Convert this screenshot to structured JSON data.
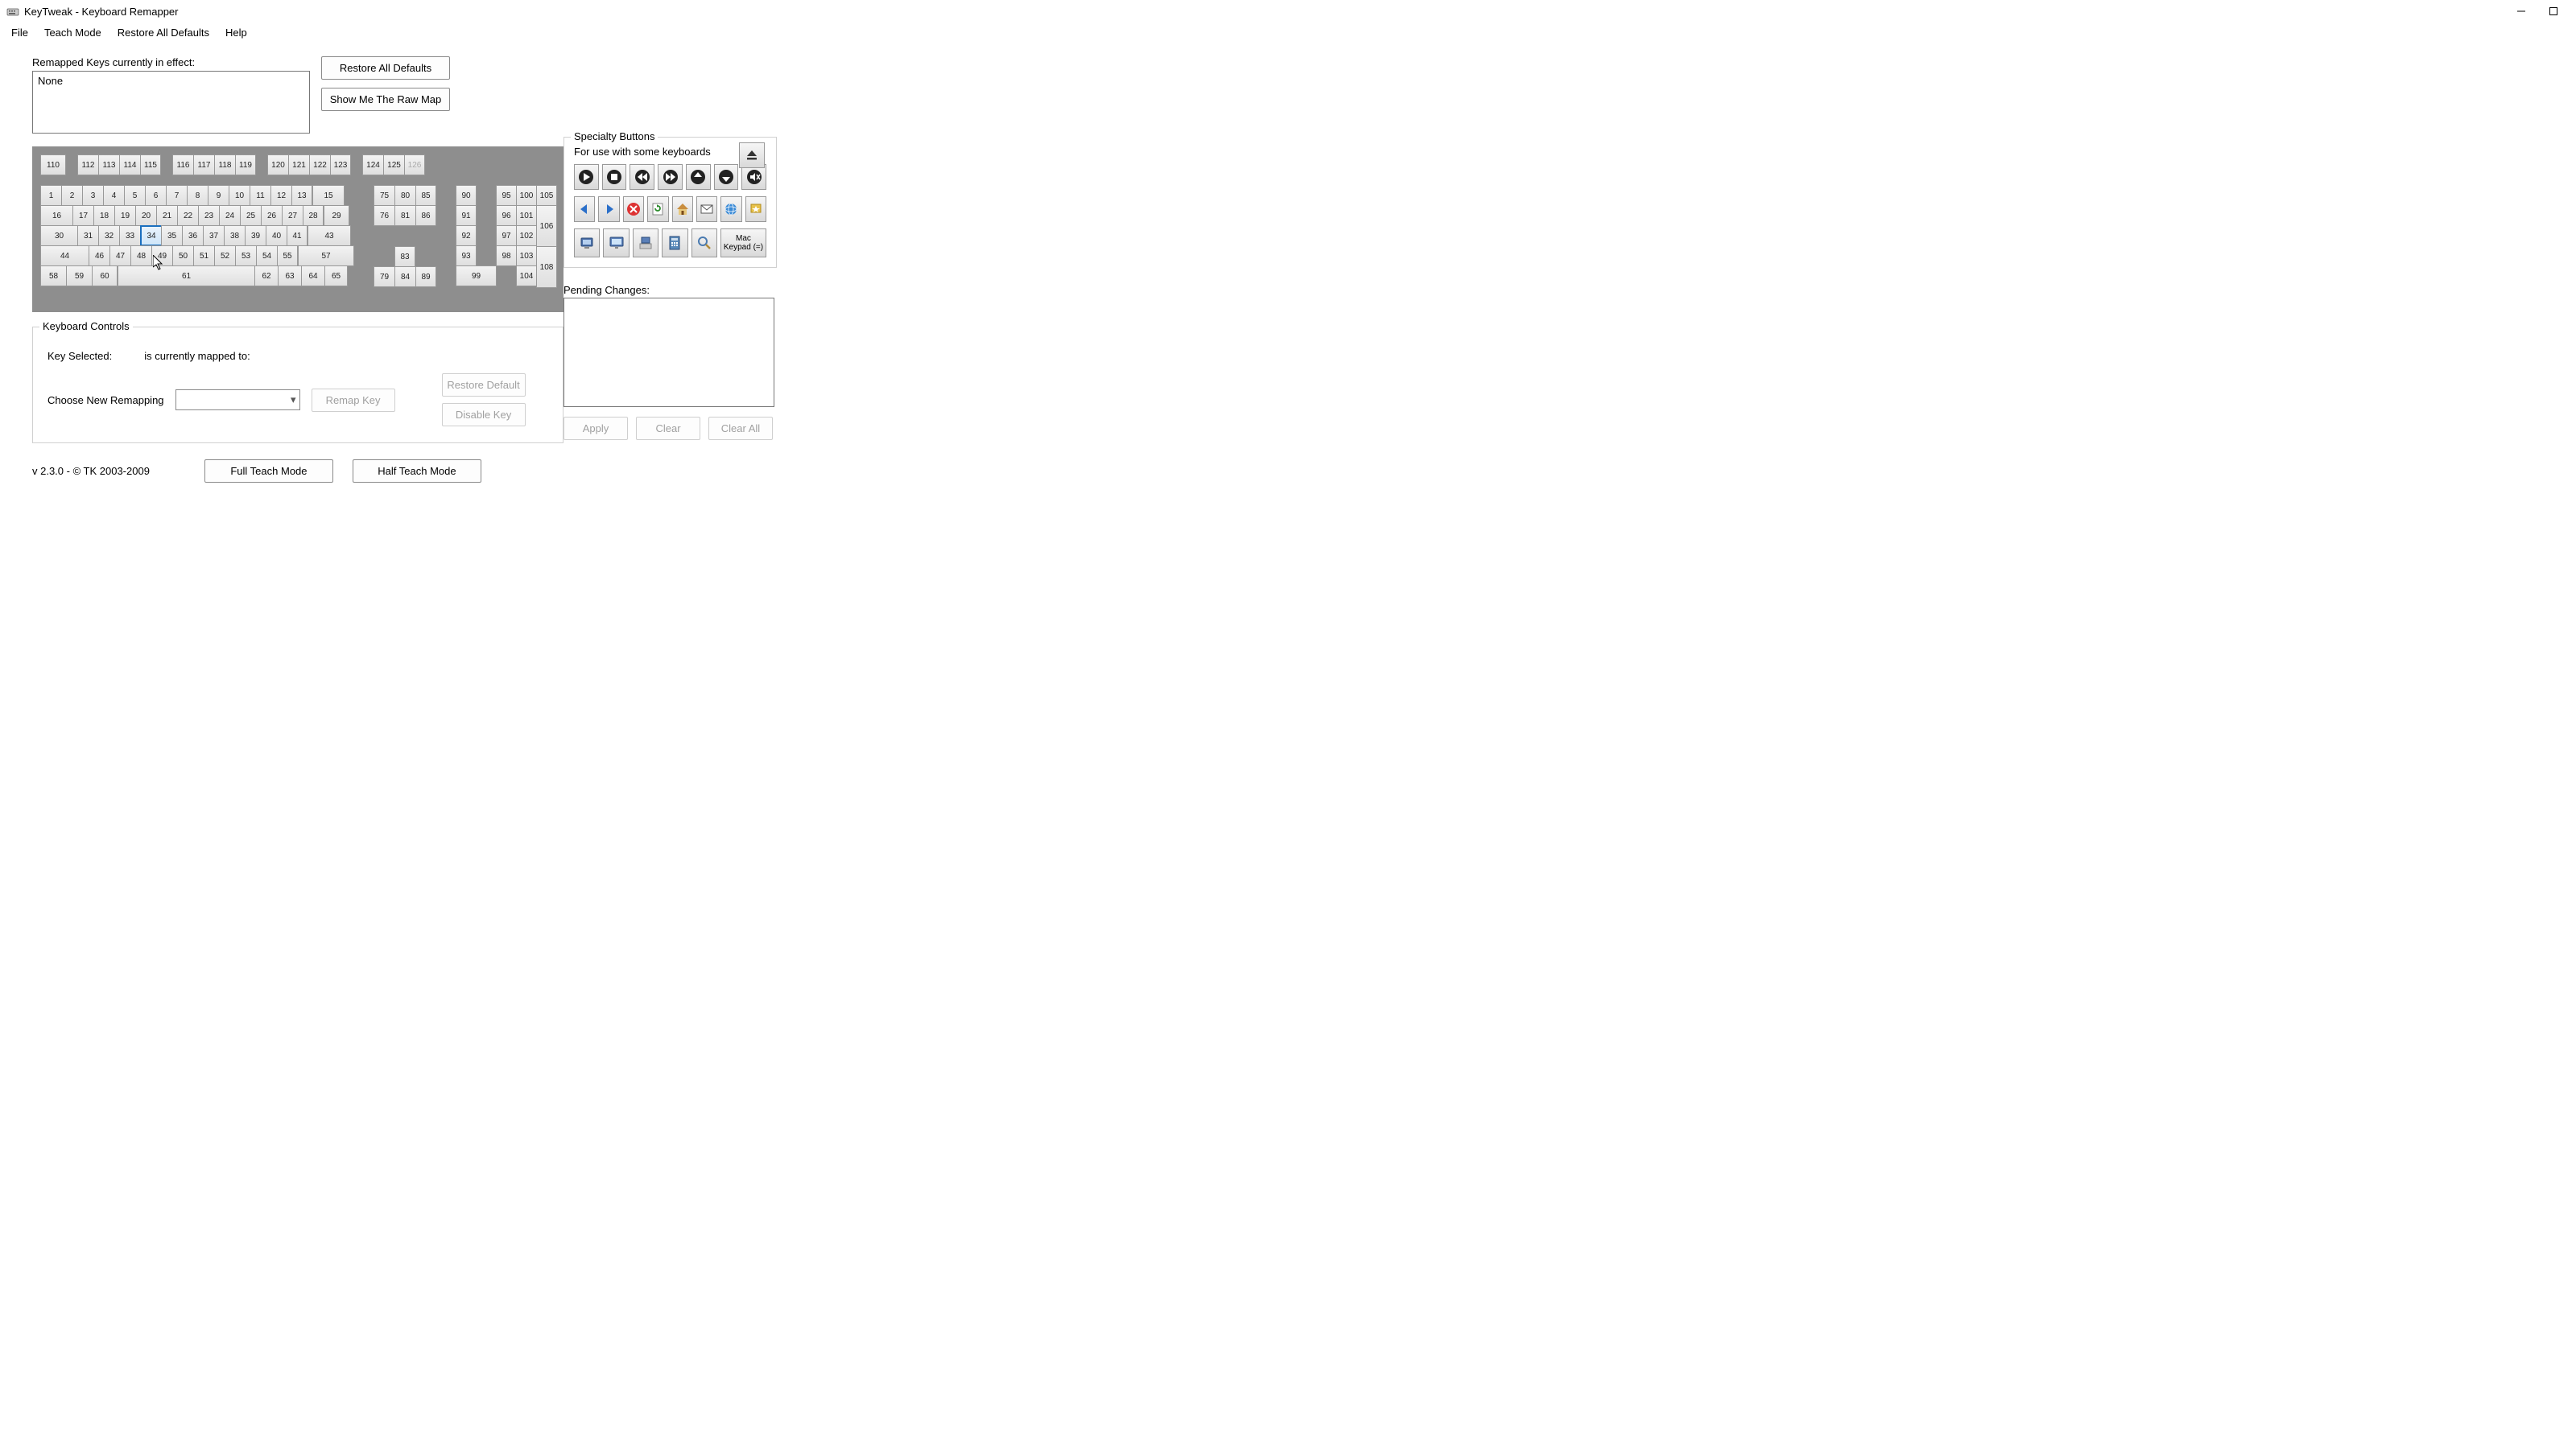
{
  "window": {
    "title": "KeyTweak -   Keyboard Remapper"
  },
  "menu": {
    "file": "File",
    "teach": "Teach Mode",
    "restore": "Restore All Defaults",
    "help": "Help"
  },
  "remapped": {
    "label": "Remapped Keys currently in effect:",
    "value": "None"
  },
  "buttons": {
    "restore_all": "Restore All Defaults",
    "raw_map": "Show Me The Raw Map",
    "remap_key": "Remap Key",
    "restore_default": "Restore Default",
    "disable_key": "Disable Key",
    "full_teach": "Full Teach Mode",
    "half_teach": "Half Teach Mode",
    "apply": "Apply",
    "clear": "Clear",
    "clear_all": "Clear All"
  },
  "keyboard": {
    "func_esc": "110",
    "func1": [
      "112",
      "113",
      "114",
      "115"
    ],
    "func2": [
      "116",
      "117",
      "118",
      "119"
    ],
    "func3": [
      "120",
      "121",
      "122",
      "123"
    ],
    "func4": [
      "124",
      "125",
      "126"
    ],
    "row1": [
      "1",
      "2",
      "3",
      "4",
      "5",
      "6",
      "7",
      "8",
      "9",
      "10",
      "11",
      "12",
      "13"
    ],
    "row1_bksp": "15",
    "row2_tab": "16",
    "row2": [
      "17",
      "18",
      "19",
      "20",
      "21",
      "22",
      "23",
      "24",
      "25",
      "26",
      "27",
      "28"
    ],
    "row2_bslash": "29",
    "row3_caps": "30",
    "row3": [
      "31",
      "32",
      "33",
      "34",
      "35",
      "36",
      "37",
      "38",
      "39",
      "40",
      "41"
    ],
    "row3_enter": "43",
    "row4_lshift": "44",
    "row4": [
      "46",
      "47",
      "48",
      "49",
      "50",
      "51",
      "52",
      "53",
      "54",
      "55"
    ],
    "row4_rshift": "57",
    "row5": [
      "58",
      "59",
      "60"
    ],
    "row5_space": "61",
    "row5_right": [
      "62",
      "63",
      "64",
      "65"
    ],
    "nav1": [
      "75",
      "80",
      "85"
    ],
    "nav2": [
      "76",
      "81",
      "86"
    ],
    "nav_up": "83",
    "nav_bottom": [
      "79",
      "84",
      "89"
    ],
    "num_col1": [
      "90",
      "91",
      "92",
      "93"
    ],
    "num_99": "99",
    "num_col2": [
      "95",
      "96",
      "97",
      "98"
    ],
    "num_col3": [
      "100",
      "101",
      "102",
      "103",
      "104"
    ],
    "num_col4": [
      "105",
      "106",
      "108"
    ],
    "selected_key": "34"
  },
  "specialty": {
    "title": "Specialty Buttons",
    "sub": "For use with some keyboards",
    "mac1": "Mac",
    "mac2": "Keypad (=)"
  },
  "kc": {
    "title": "Keyboard Controls",
    "key_selected": "Key Selected:",
    "mapped_to": "is currently mapped to:",
    "choose": "Choose New Remapping"
  },
  "pending": {
    "label": "Pending Changes:"
  },
  "version": "v 2.3.0 - © TK 2003-2009"
}
